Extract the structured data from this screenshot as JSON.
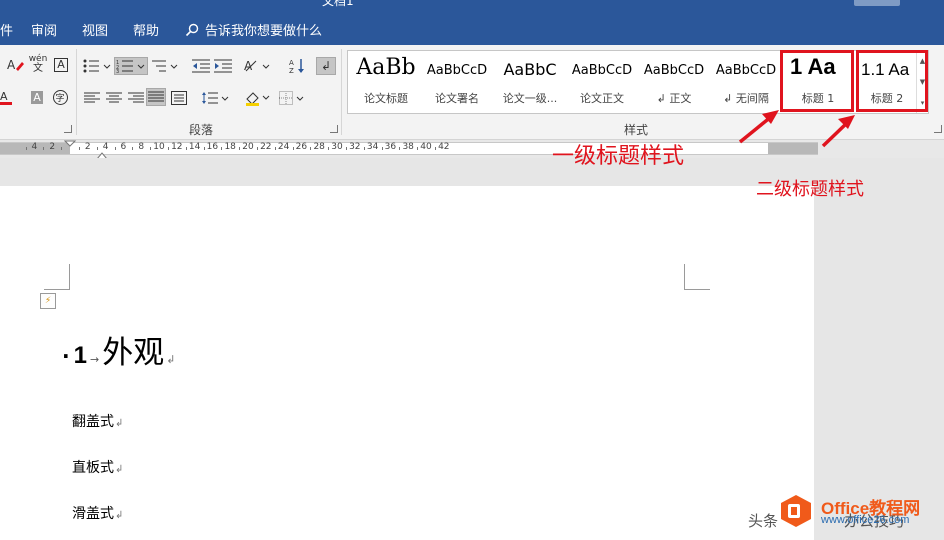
{
  "window": {
    "title": "文档1"
  },
  "tabs": [
    {
      "label": "件"
    },
    {
      "label": "审阅"
    },
    {
      "label": "视图"
    },
    {
      "label": "帮助"
    }
  ],
  "tell_me": {
    "placeholder": "告诉我你想要做什么"
  },
  "ribbon": {
    "paragraph_group_label": "段落",
    "styles_group_label": "样式",
    "phonetic_label": "wén",
    "styles": [
      {
        "sample": "AaBb",
        "name": "论文标题"
      },
      {
        "sample": "AaBbCcD",
        "name": "论文署名"
      },
      {
        "sample": "AaBbC",
        "name": "论文一级..."
      },
      {
        "sample": "AaBbCcD",
        "name": "论文正文"
      },
      {
        "sample": "AaBbCcD",
        "name": "↲ 正文"
      },
      {
        "sample": "AaBbCcD",
        "name": "↲ 无间隔"
      },
      {
        "sample": "1  Aa",
        "name": "标题 1"
      },
      {
        "sample": "1.1  Aa",
        "name": "标题 2"
      }
    ]
  },
  "ruler": {
    "labels": [
      "4",
      "2",
      "2",
      "4",
      "6",
      "8",
      "10",
      "12",
      "14",
      "16",
      "18",
      "20",
      "22",
      "24",
      "26",
      "28",
      "30",
      "32",
      "34",
      "36",
      "38",
      "40",
      "42"
    ]
  },
  "annotations": {
    "level1": "一级标题样式",
    "level2": "二级标题样式",
    "color": "#e0141e"
  },
  "document": {
    "heading": {
      "number": "1",
      "text": "外观"
    },
    "paragraphs": [
      "翻盖式",
      "直板式",
      "滑盖式"
    ]
  },
  "watermark": {
    "prefix": "头条",
    "site_name": "Office教程网",
    "url": "www.office26.com",
    "suffix": "办公技巧"
  },
  "colors": {
    "titlebar": "#2b579a",
    "ribbon": "#f3f3f3",
    "accent_red": "#e0141e"
  }
}
